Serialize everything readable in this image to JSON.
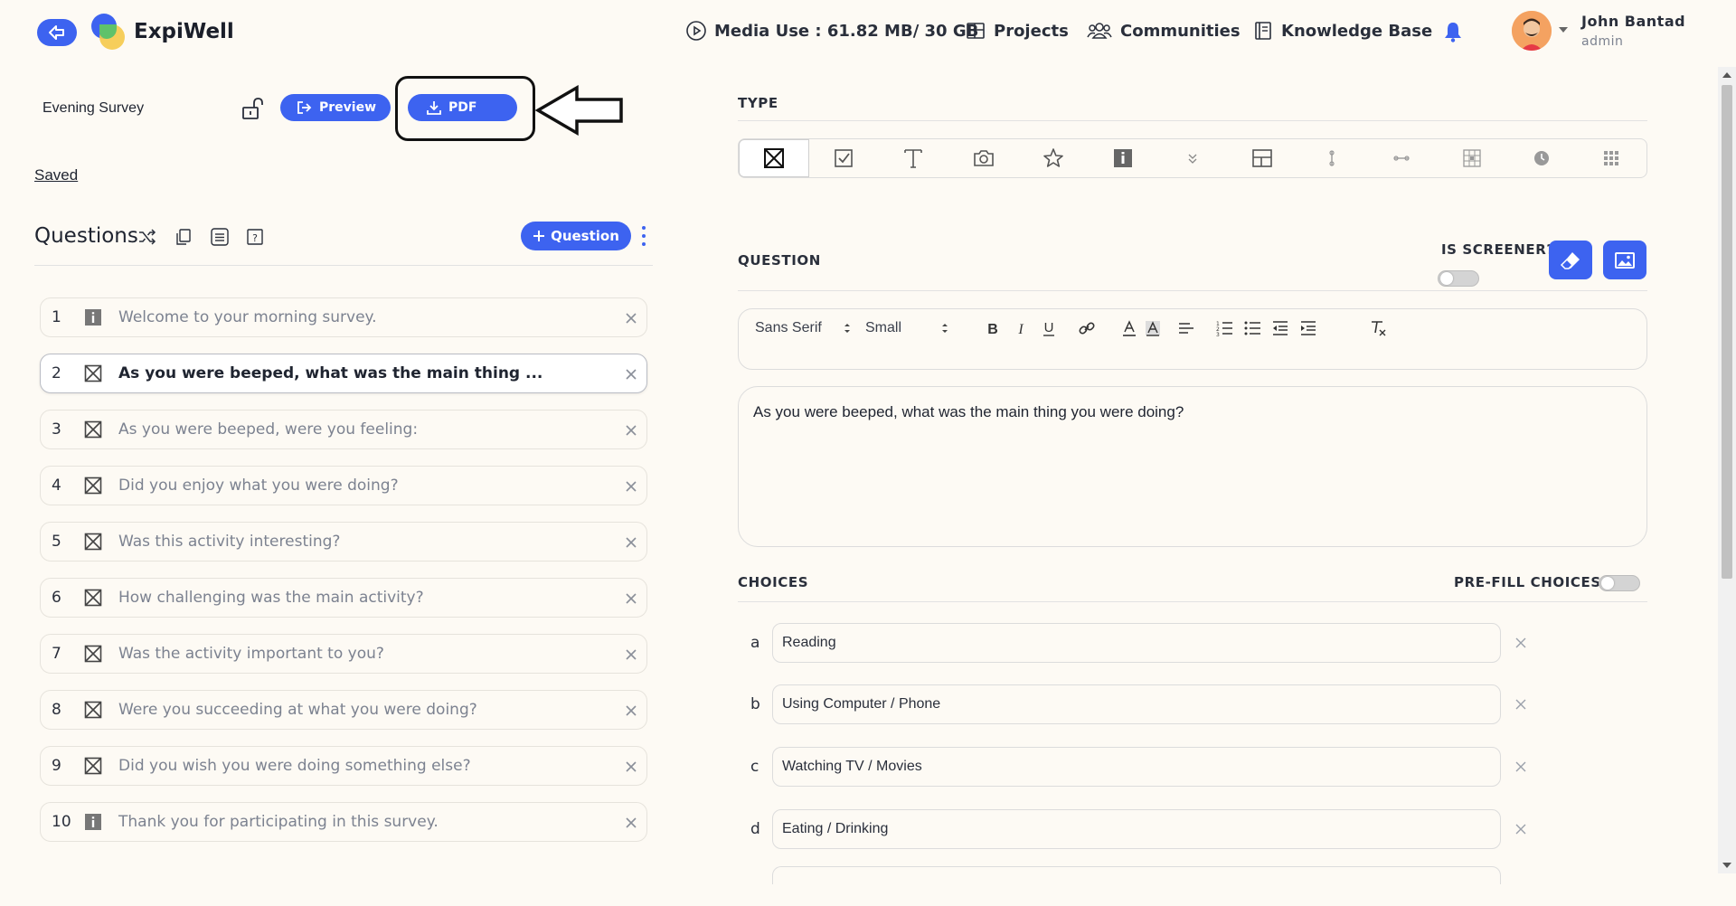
{
  "header": {
    "brand": "ExpiWell",
    "media_use": "Media Use : 61.82 MB/ 30 GB",
    "projects": "Projects",
    "communities": "Communities",
    "knowledge_base": "Knowledge Base",
    "user_name": "John Bantad",
    "user_role": "admin"
  },
  "survey": {
    "name": "Evening Survey",
    "preview_label": "Preview",
    "pdf_label": "PDF",
    "status": "Saved"
  },
  "questions_panel": {
    "title": "Questions",
    "add_label": "Question",
    "items": [
      {
        "num": "1",
        "type": "info",
        "text": "Welcome to your morning survey."
      },
      {
        "num": "2",
        "type": "multiple-choice",
        "text": "As you were beeped, what was the main thing ..."
      },
      {
        "num": "3",
        "type": "multiple-choice",
        "text": "As you were beeped, were you feeling:"
      },
      {
        "num": "4",
        "type": "multiple-choice",
        "text": "Did you enjoy what you were doing?"
      },
      {
        "num": "5",
        "type": "multiple-choice",
        "text": "Was this activity interesting?"
      },
      {
        "num": "6",
        "type": "multiple-choice",
        "text": "How challenging was the main activity?"
      },
      {
        "num": "7",
        "type": "multiple-choice",
        "text": "Was the activity important to you?"
      },
      {
        "num": "8",
        "type": "multiple-choice",
        "text": "Were you succeeding at what you were doing?"
      },
      {
        "num": "9",
        "type": "multiple-choice",
        "text": "Did you wish you were doing something else?"
      },
      {
        "num": "10",
        "type": "info",
        "text": "Thank you for participating in this survey."
      }
    ],
    "active_index": 1
  },
  "editor": {
    "type_label": "TYPE",
    "question_label": "QUESTION",
    "screener_label": "IS SCREENER?",
    "font_family": "Sans Serif",
    "font_size": "Small",
    "question_text": "As you were beeped, what was the main thing you were doing?",
    "choices_label": "CHOICES",
    "prefill_label": "PRE-FILL CHOICES?",
    "choices": [
      {
        "letter": "a",
        "text": "Reading"
      },
      {
        "letter": "b",
        "text": "Using Computer / Phone"
      },
      {
        "letter": "c",
        "text": "Watching TV / Movies"
      },
      {
        "letter": "d",
        "text": "Eating / Drinking"
      }
    ]
  },
  "colors": {
    "accent": "#3d63f0",
    "background": "#fdfaf4"
  }
}
